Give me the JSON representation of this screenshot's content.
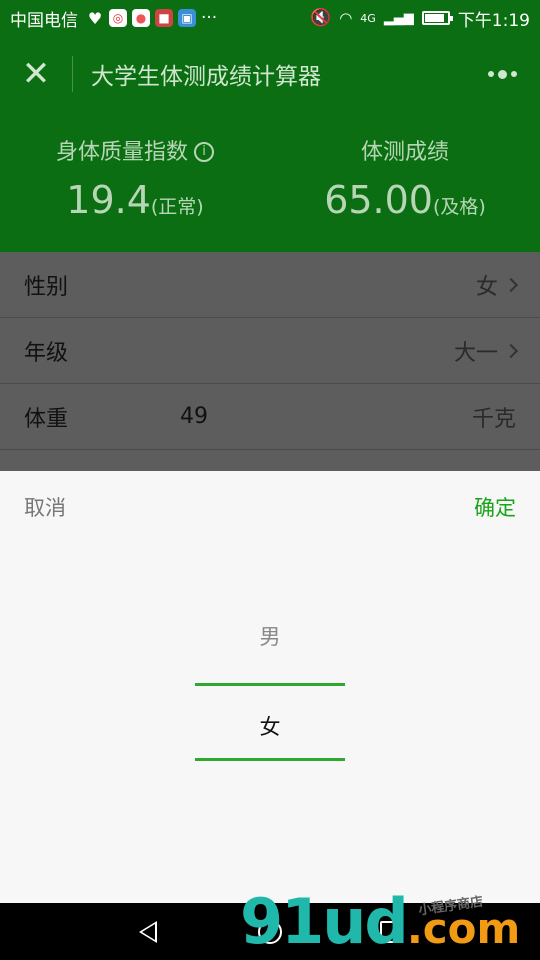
{
  "status": {
    "carrier": "中国电信",
    "time": "下午1:19",
    "network": "4G",
    "dots": "···",
    "battery_level": 0.85
  },
  "header": {
    "title": "大学生体测成绩计算器"
  },
  "summary": {
    "bmi_label": "身体质量指数",
    "bmi_info_icon": "ⓘ",
    "bmi_value": "19.4",
    "bmi_status": "(正常)",
    "score_label": "体测成绩",
    "score_value": "65.00",
    "score_status": "(及格)"
  },
  "form": {
    "gender_label": "性别",
    "gender_value": "女",
    "grade_label": "年级",
    "grade_value": "大一",
    "weight_label": "体重",
    "weight_value": "49",
    "weight_unit": "千克"
  },
  "picker": {
    "cancel": "取消",
    "confirm": "确定",
    "options": [
      "男",
      "女"
    ],
    "selected": "女"
  },
  "watermark": {
    "main": "91ud",
    "com": ".com",
    "small": "小程序商店"
  },
  "colors": {
    "header_green": "#0c6e12",
    "accent_green": "#1aa31a"
  }
}
